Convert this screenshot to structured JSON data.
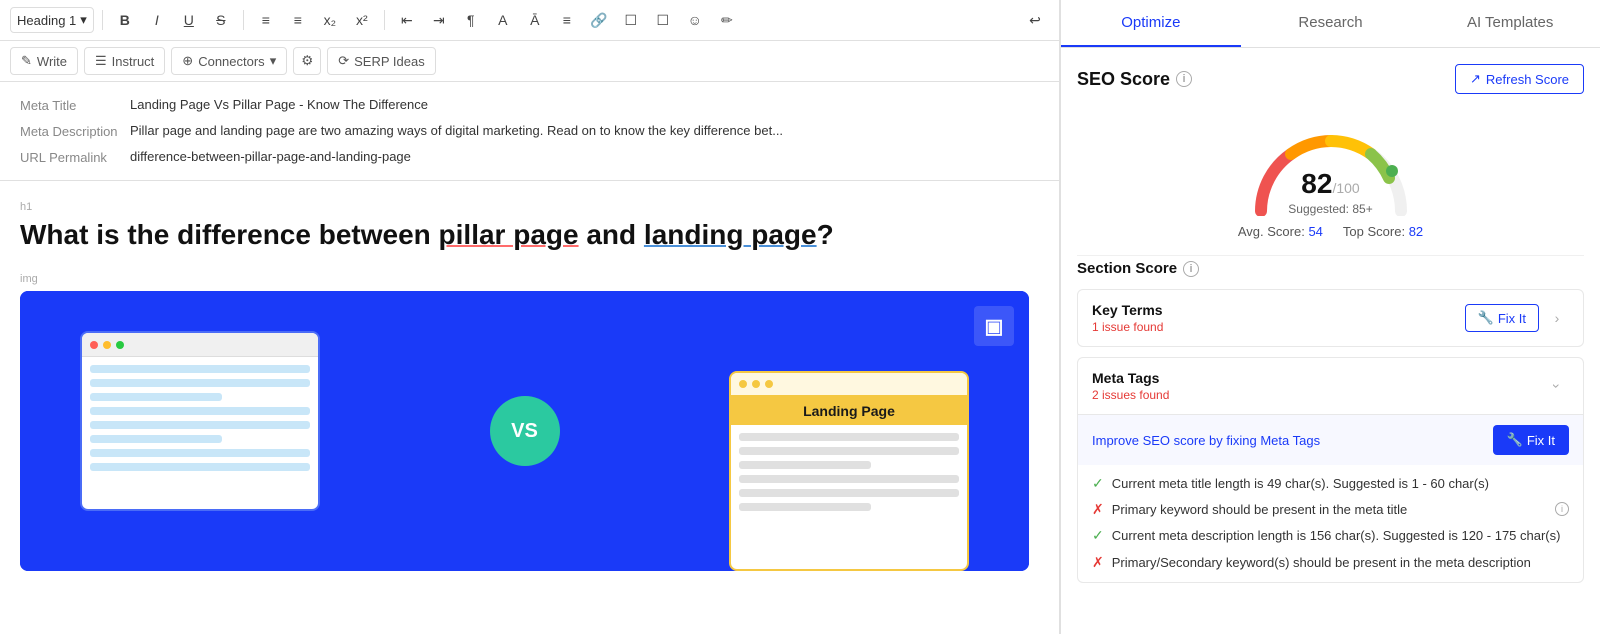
{
  "toolbar": {
    "heading_label": "Heading 1",
    "history_icon": "↩",
    "buttons": [
      "B",
      "I",
      "U",
      "S",
      "≡",
      "≡",
      "x₂",
      "x²",
      "⬛",
      "⬛",
      "¶",
      "A",
      "Ā",
      "≡",
      "🔗",
      "☐",
      "☐",
      "☺",
      "✏"
    ]
  },
  "sub_toolbar": {
    "write_label": "Write",
    "instruct_label": "Instruct",
    "connectors_label": "Connectors",
    "settings_label": "⚙",
    "serp_label": "SERP Ideas"
  },
  "meta": {
    "title_label": "Meta Title",
    "title_value": "Landing Page Vs Pillar Page - Know The Difference",
    "description_label": "Meta Description",
    "description_value": "Pillar page and landing page are two amazing ways of digital marketing. Read on to know the key difference bet...",
    "url_label": "URL Permalink",
    "url_value": "difference-between-pillar-page-and-landing-page"
  },
  "article": {
    "h1_label": "h1",
    "title": "What is the difference between pillar page and landing page?",
    "title_part1": "What is the difference between ",
    "title_highlight1": "pillar page",
    "title_part2": " and ",
    "title_highlight2": "landing page",
    "title_part3": "?",
    "img_label": "img",
    "vs_text": "VS",
    "landing_page_label": "Landing Page",
    "corner_logo": "▣"
  },
  "right_panel": {
    "tabs": {
      "optimize": "Optimize",
      "research": "Research",
      "ai_templates": "AI Templates"
    },
    "seo_score": {
      "title": "SEO Score",
      "refresh_label": "Refresh Score",
      "score": "82",
      "max": "/100",
      "suggested": "Suggested: 85+",
      "avg_label": "Avg. Score:",
      "avg_value": "54",
      "top_label": "Top Score:",
      "top_value": "82"
    },
    "section_score": {
      "title": "Section Score"
    },
    "key_terms": {
      "title": "Key Terms",
      "issue": "1 issue found",
      "fix_label": "Fix It"
    },
    "meta_tags": {
      "title": "Meta Tags",
      "issue": "2 issues found",
      "fix_label": "Fix It",
      "improve_text": "Improve SEO score by fixing Meta Tags",
      "checks": [
        {
          "ok": true,
          "text": "Current meta title length is 49 char(s). Suggested is 1 - 60 char(s)",
          "has_info": false
        },
        {
          "ok": false,
          "text": "Primary keyword should be present in the meta title",
          "has_info": true
        },
        {
          "ok": true,
          "text": "Current meta description length is 156 char(s). Suggested is 120 - 175 char(s)",
          "has_info": false
        },
        {
          "ok": false,
          "text": "Primary/Secondary keyword(s) should be present in the meta description",
          "has_info": false
        }
      ]
    }
  }
}
